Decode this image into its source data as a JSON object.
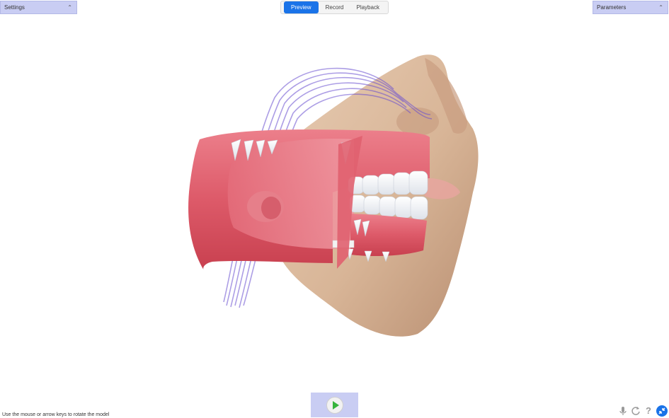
{
  "settings_panel": {
    "title": "Settings",
    "chevron": "chevron-up-icon"
  },
  "parameters_panel": {
    "title": "Parameters",
    "chevron": "chevron-up-icon"
  },
  "tabs": [
    {
      "label": "Preview",
      "active": true
    },
    {
      "label": "Record",
      "active": false
    },
    {
      "label": "Playback",
      "active": false
    }
  ],
  "controls": {
    "play_icon": "play-icon",
    "hint": "Use the mouse or arrow keys to rotate the model"
  },
  "bottom_icons": [
    "microphone-icon",
    "reset-icon",
    "help-icon",
    "collapse-icon"
  ],
  "colors": {
    "accent": "#1a73e8",
    "panel": "#c9cdf3",
    "play": "#36b43d",
    "gum": "#e0606f",
    "skin": "#d9b79a",
    "airflow": "#6a4fd0"
  }
}
